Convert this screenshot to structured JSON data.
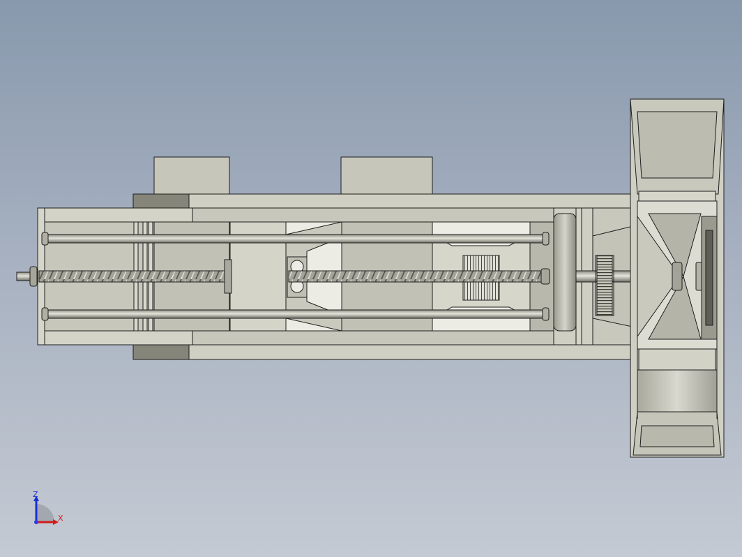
{
  "viewport": {
    "background_top": "#8899ad",
    "background_bottom": "#c4cad3"
  },
  "model": {
    "part_fill": "#cfcfc3",
    "part_shade": "#a9a99c",
    "dark_fill": "#85857a",
    "light_fill": "#ecece4",
    "edge_color": "#1e1e1e"
  },
  "triad": {
    "z_label": "Z",
    "x_label": "X",
    "z_color": "#1a2fd6",
    "x_color": "#d21a1a"
  }
}
